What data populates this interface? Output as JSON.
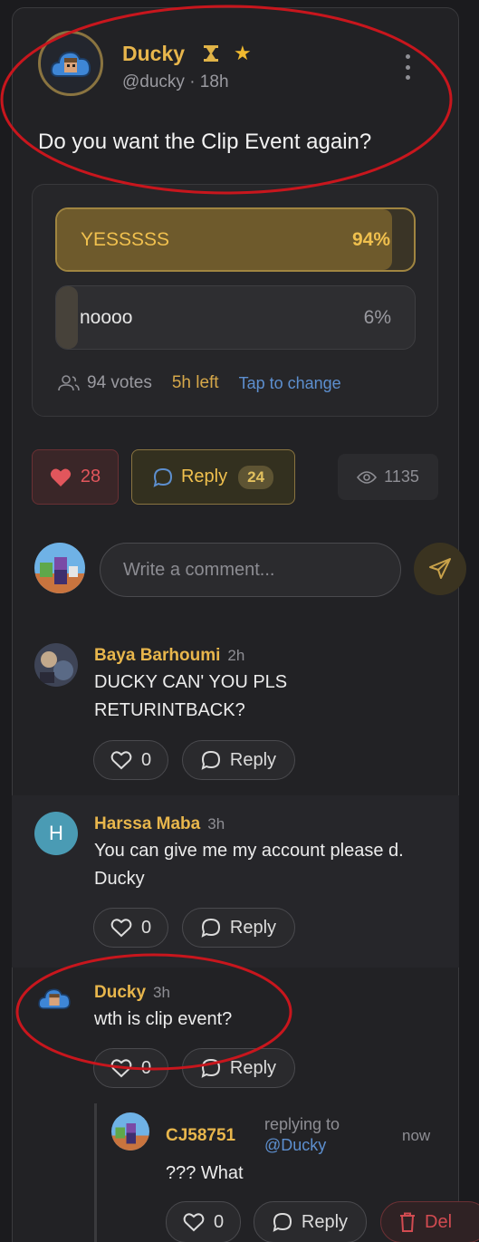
{
  "post": {
    "author_name": "Ducky",
    "handle": "@ducky",
    "time_ago": "· 18h",
    "text": "Do you want the Clip Event again?",
    "badges": [
      "hourglass-icon",
      "star-icon"
    ]
  },
  "poll": {
    "options": [
      {
        "label": "YESSSSS",
        "percent_text": "94%",
        "percent": 94
      },
      {
        "label": "noooo",
        "percent_text": "6%",
        "percent": 6
      }
    ],
    "votes": "94 votes",
    "time_left": "5h left",
    "tap_to_change": "Tap to change"
  },
  "actions": {
    "likes": "28",
    "reply_label": "Reply",
    "reply_count": "24",
    "views": "1135"
  },
  "composer": {
    "placeholder": "Write a comment..."
  },
  "comments": [
    {
      "name": "Baya Barhoumi",
      "time": "2h",
      "text": "DUCKY CAN' YOU PLS RETURINTBACK?",
      "likes": "0",
      "reply_label": "Reply"
    },
    {
      "name": "Harssa Maba",
      "time": "3h",
      "avatar_letter": "H",
      "text": "You can give me my account please d. Ducky",
      "likes": "0",
      "reply_label": "Reply"
    },
    {
      "name": "Ducky",
      "time": "3h",
      "text": "wth is clip event?",
      "likes": "0",
      "reply_label": "Reply"
    }
  ],
  "nested_reply": {
    "name": "CJ58751",
    "replying_to_label": "replying to",
    "mention": "@Ducky",
    "time": "now",
    "text": "??? What",
    "likes": "0",
    "reply_label": "Reply",
    "delete_label": "Del"
  },
  "colors": {
    "accent_gold": "#e8b64c",
    "like_red": "#e2565c",
    "link_blue": "#5d8fcf",
    "annotation_red": "#c8161d"
  }
}
